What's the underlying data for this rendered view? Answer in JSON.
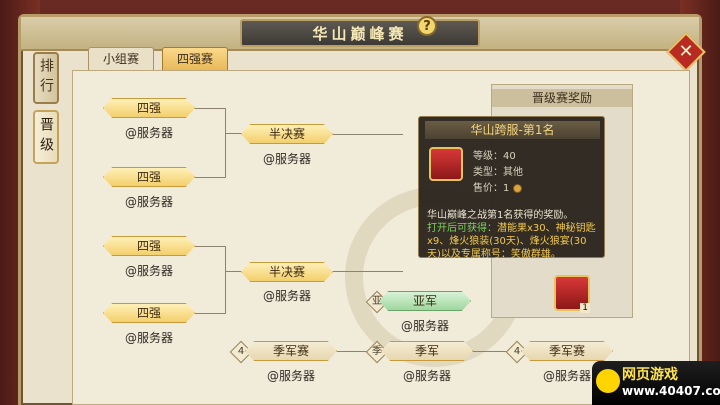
{
  "window": {
    "title": "华山巅峰赛"
  },
  "side_tabs": [
    {
      "label": "排行"
    },
    {
      "label": "晋级"
    }
  ],
  "tabs": [
    {
      "label": "小组赛"
    },
    {
      "label": "四强赛"
    }
  ],
  "bracket": {
    "quarter_label": "四强",
    "semi_label": "半决赛",
    "server_label": "@服务器",
    "runner_up_label": "亚军",
    "third_place_match_label": "季军赛",
    "third_place_label": "季军",
    "badge_runner_up": "亚",
    "badge_third": "季",
    "badge_four": "4"
  },
  "reward_panel": {
    "header": "晋级赛奖励",
    "chest_count": "1"
  },
  "tooltip": {
    "title": "华山跨服-第1名",
    "level_label": "等级：",
    "level_value": "40",
    "type_label": "类型：",
    "type_value": "其他",
    "price_label": "售价：",
    "price_value": "1",
    "desc": "华山巅峰之战第1名获得的奖励。",
    "open_label": "打开后可获得：",
    "open_items": "潜能果x30、神秘钥匙x9、烽火狼装(30天)、烽火狼宴(30天)以及专属称号：",
    "title_reward": "笑傲群雄。"
  },
  "logo": {
    "line1": "网页游戏",
    "line2": "www.40407.com"
  }
}
